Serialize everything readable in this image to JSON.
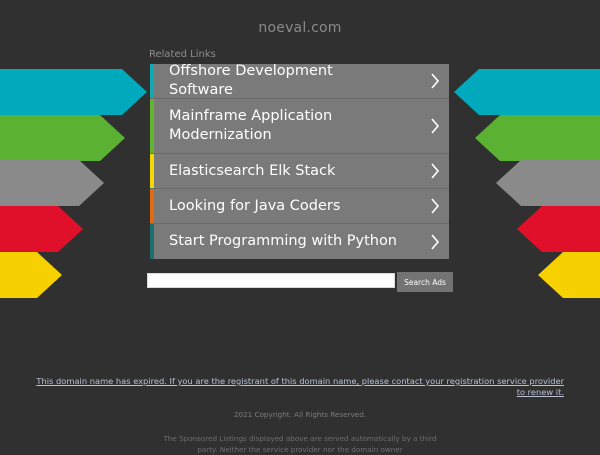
{
  "header": {
    "domain": "noeval.com"
  },
  "related": {
    "label": "Related Links",
    "items": [
      {
        "label": "Offshore Development Software",
        "accent": "#14a8b5"
      },
      {
        "label": "Mainframe Application Modernization",
        "accent": "#64b432"
      },
      {
        "label": "Elasticsearch Elk Stack",
        "accent": "#f5d800"
      },
      {
        "label": "Looking for Java Coders",
        "accent": "#e26a12"
      },
      {
        "label": "Start Programming with Python",
        "accent": "#1f6e70"
      }
    ]
  },
  "search": {
    "button_label": "Search Ads",
    "value": ""
  },
  "footer": {
    "expired_notice": "This domain name has expired. If you are the registrant of this domain name, please contact your registration service provider to renew it.",
    "copyright": "2021 Copyright. All Rights Reserved.",
    "sponsored": "The Sponsored Listings displayed above are served automatically by a third party. Neither the service provider nor the domain owner"
  },
  "colors": {
    "background": "#303030",
    "arrow_teal": "#00a9bb",
    "arrow_green": "#5ab132",
    "arrow_gray": "#8a8a8a",
    "arrow_red": "#e0102a",
    "arrow_yellow": "#f7d000"
  }
}
